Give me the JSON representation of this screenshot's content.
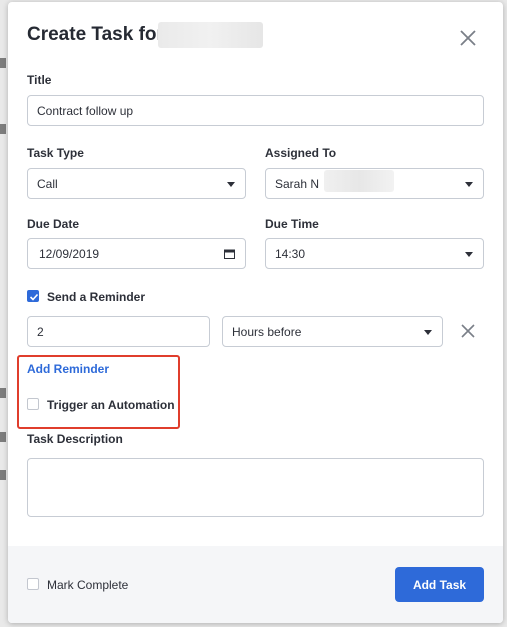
{
  "modal": {
    "title": "Create Task for"
  },
  "form": {
    "title": {
      "label": "Title",
      "value": "Contract follow up"
    },
    "task_type": {
      "label": "Task Type",
      "value": "Call"
    },
    "assigned_to": {
      "label": "Assigned To",
      "value": "Sarah N"
    },
    "due_date": {
      "label": "Due Date",
      "value": "12/09/2019"
    },
    "due_time": {
      "label": "Due Time",
      "value": "14:30"
    },
    "reminder": {
      "label": "Send a Reminder",
      "checked": true,
      "amount": "2",
      "unit": "Hours before"
    },
    "add_reminder": "Add Reminder",
    "trigger_automation": {
      "label": "Trigger an Automation",
      "checked": false
    },
    "description": {
      "label": "Task Description",
      "value": ""
    }
  },
  "footer": {
    "mark_complete": {
      "label": "Mark Complete",
      "checked": false
    },
    "add_task_label": "Add Task"
  },
  "colors": {
    "accent": "#2e6ad9",
    "highlight": "#e03d2c"
  }
}
